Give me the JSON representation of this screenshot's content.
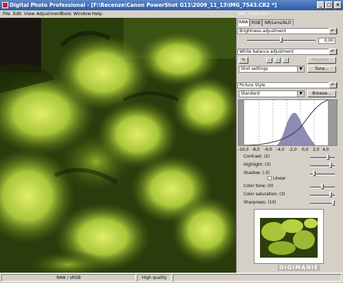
{
  "window": {
    "title": "Digital Photo Professional - [F:\\Recenze\\Canon PowerShot G11\\2009_11_13\\IMG_7543.CR2 *]",
    "min": "_",
    "max": "□",
    "close": "×"
  },
  "menu": [
    "File",
    "Edit",
    "View",
    "Adjustment",
    "Tools",
    "Window",
    "Help"
  ],
  "panel": {
    "filename": "IMG_7543.CR2 *",
    "tabs": [
      "RAW",
      "RGB",
      "NR/Lens/ALO"
    ],
    "brightness": {
      "label": "Brightness adjustment",
      "value": "0,00",
      "level": 0.0
    },
    "white_balance": {
      "label": "White balance adjustment",
      "presets": [
        "1",
        "2",
        "3"
      ],
      "register": "Register...",
      "select": "Shot settings",
      "tune": "Tune..."
    },
    "picture_style": {
      "label": "Picture Style",
      "select": "Standard",
      "browse": "Browse..."
    },
    "histogram": {
      "axis_ticks": [
        "-10,0",
        "-8,0",
        "-6,0",
        "-4,0",
        "-2,0",
        "0,0",
        "2,0",
        "4,0"
      ]
    },
    "sliders": [
      {
        "label": "Contrast: (2)",
        "value": 2
      },
      {
        "label": "Highlight: (3)",
        "value": 3
      },
      {
        "label": "Shadow: (-3)",
        "value": -3
      },
      {
        "label": "Color tone: (0)",
        "value": 0
      },
      {
        "label": "Color saturation: (3)",
        "value": 3
      },
      {
        "label": "Sharpness: (10)",
        "value": 10
      }
    ],
    "linear": "Linear"
  },
  "status": {
    "color_space": "RAW / sRGB",
    "quality": "High quality"
  },
  "watermark": "DIGIMANIE",
  "colors": {
    "title_gradient_top": "#5f88c7",
    "title_gradient_bottom": "#2a5aa8",
    "moss_bright": "#b8d43a",
    "moss_dark": "#1e2c08"
  }
}
